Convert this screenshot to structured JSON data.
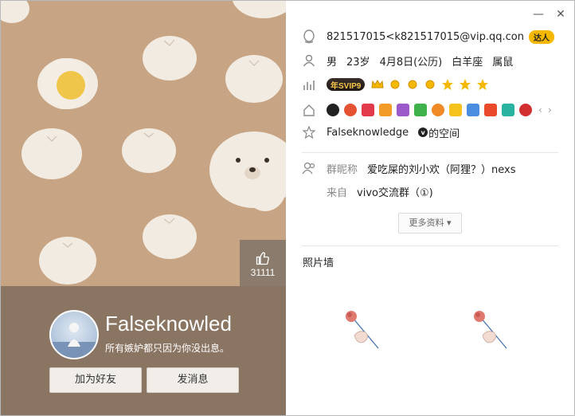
{
  "window": {
    "minimize_glyph": "—",
    "close_glyph": "✕"
  },
  "left": {
    "likes": "31111",
    "nickname": "Falseknowled",
    "signature": "所有嫉妒都只因为你没出息。",
    "add_friend_label": "加为好友",
    "send_message_label": "发消息",
    "background_color": "#c6a484",
    "band_color": "#8a7462"
  },
  "info": {
    "qq_email": "821517015<k821517015@vip.qq.con",
    "email_badge": "达人",
    "gender": "男",
    "age": "23岁",
    "birthday": "4月8日(公历)",
    "zodiac": "白羊座",
    "chinese_zodiac": "属鼠",
    "svip_label": "年SVIP9",
    "space_owner": "Falseknowledge",
    "space_suffix": "的空间",
    "group_nick_label": "群昵称",
    "group_nick": "爱吃屎的刘小欢（阿狸？）nexs",
    "from_label": "来自",
    "from_group": "vivo交流群（①)"
  },
  "more_label": "更多资料 ▾",
  "photo_wall_title": "照片墙",
  "icons": {
    "qq": "qq-penguin-icon",
    "person": "person-icon",
    "level": "level-chart-icon",
    "services": "services-house-icon",
    "space": "star-outline-icon",
    "group": "group-people-icon"
  }
}
